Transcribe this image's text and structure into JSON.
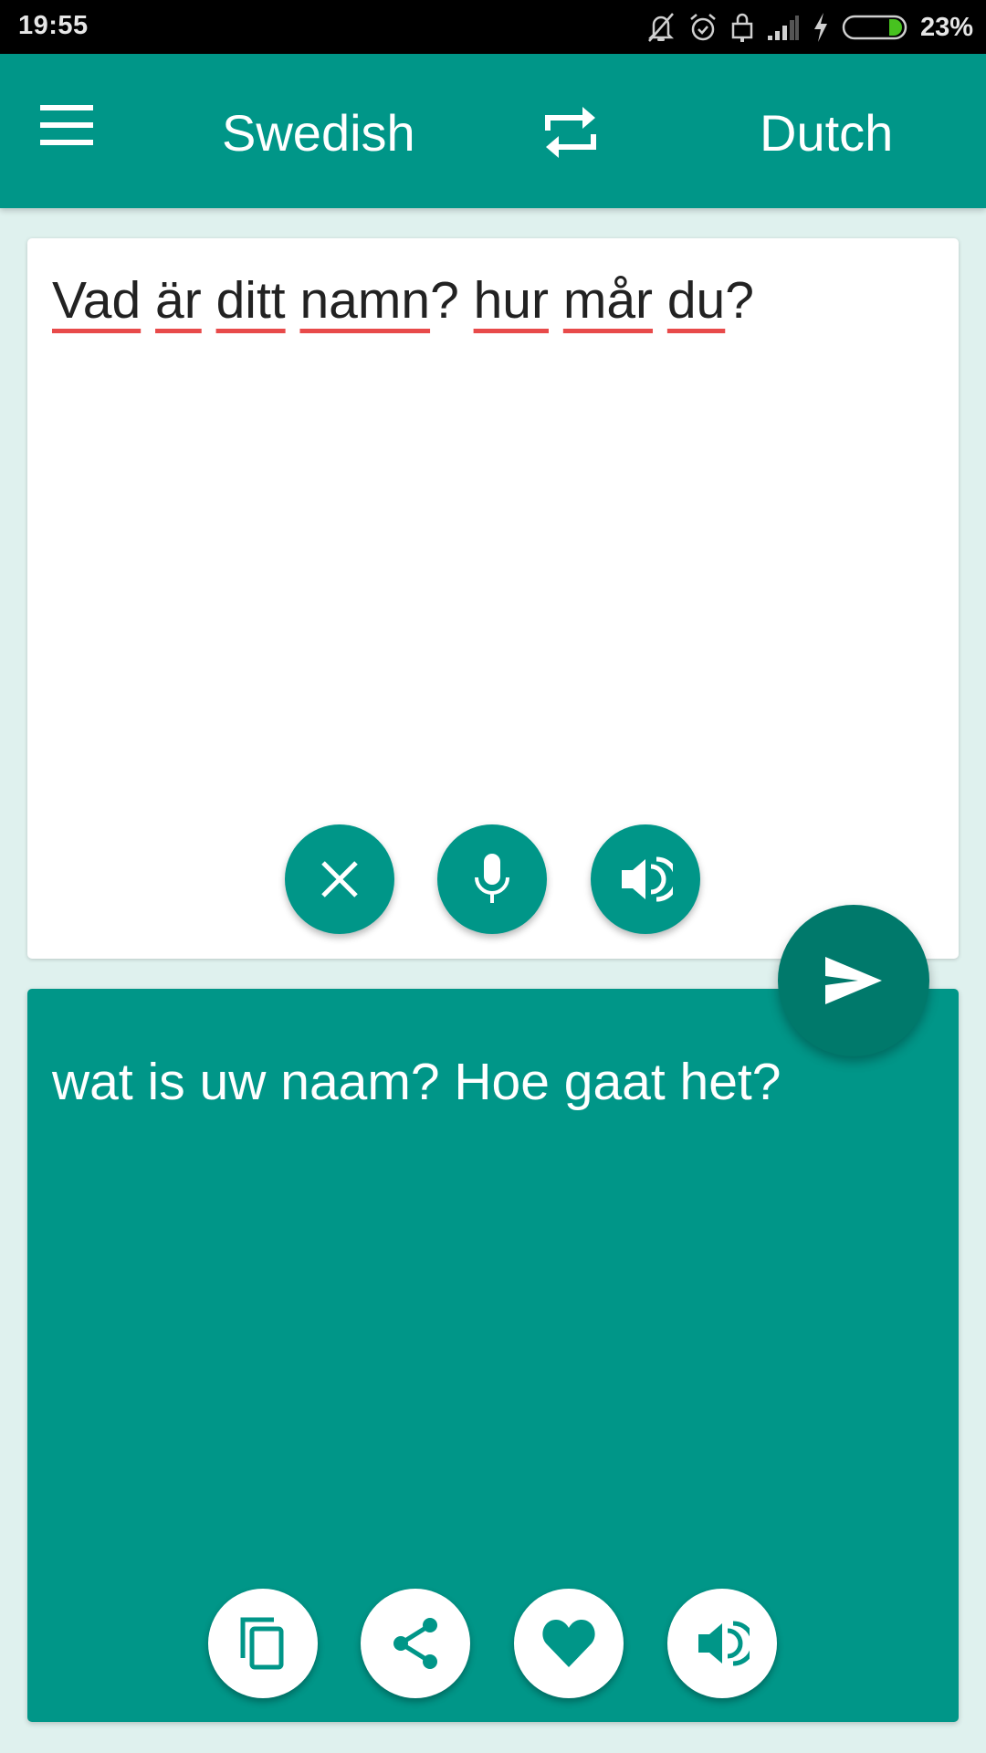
{
  "status_bar": {
    "time": "19:55",
    "icons": [
      "notifications-off-icon",
      "alarm-icon",
      "lock-icon",
      "signal-icon",
      "charging-icon",
      "battery-icon"
    ],
    "battery_percent": "23%"
  },
  "app_bar": {
    "menu_icon": "hamburger-menu-icon",
    "source_language": "Swedish",
    "swap_icon": "swap-languages-icon",
    "target_language": "Dutch"
  },
  "input": {
    "words": [
      "Vad",
      "är",
      "ditt",
      "namn",
      "?",
      "hur",
      "mår",
      "du",
      "?"
    ],
    "text": "Vad är ditt namn? hur mår du?",
    "buttons": [
      {
        "name": "clear",
        "icon": "close-icon"
      },
      {
        "name": "voice-input",
        "icon": "microphone-icon"
      },
      {
        "name": "speak-source",
        "icon": "speaker-icon"
      }
    ]
  },
  "translate_button": {
    "icon": "send-icon"
  },
  "output": {
    "text": "wat is uw naam? Hoe gaat het?",
    "buttons": [
      {
        "name": "copy",
        "icon": "copy-icon"
      },
      {
        "name": "share",
        "icon": "share-icon"
      },
      {
        "name": "favorite",
        "icon": "heart-icon"
      },
      {
        "name": "speak-translation",
        "icon": "speaker-icon"
      }
    ]
  },
  "colors": {
    "primary": "#009688",
    "primary_dark": "#00796b",
    "background": "#dff1ee",
    "spellcheck_underline": "#e84a4a"
  }
}
